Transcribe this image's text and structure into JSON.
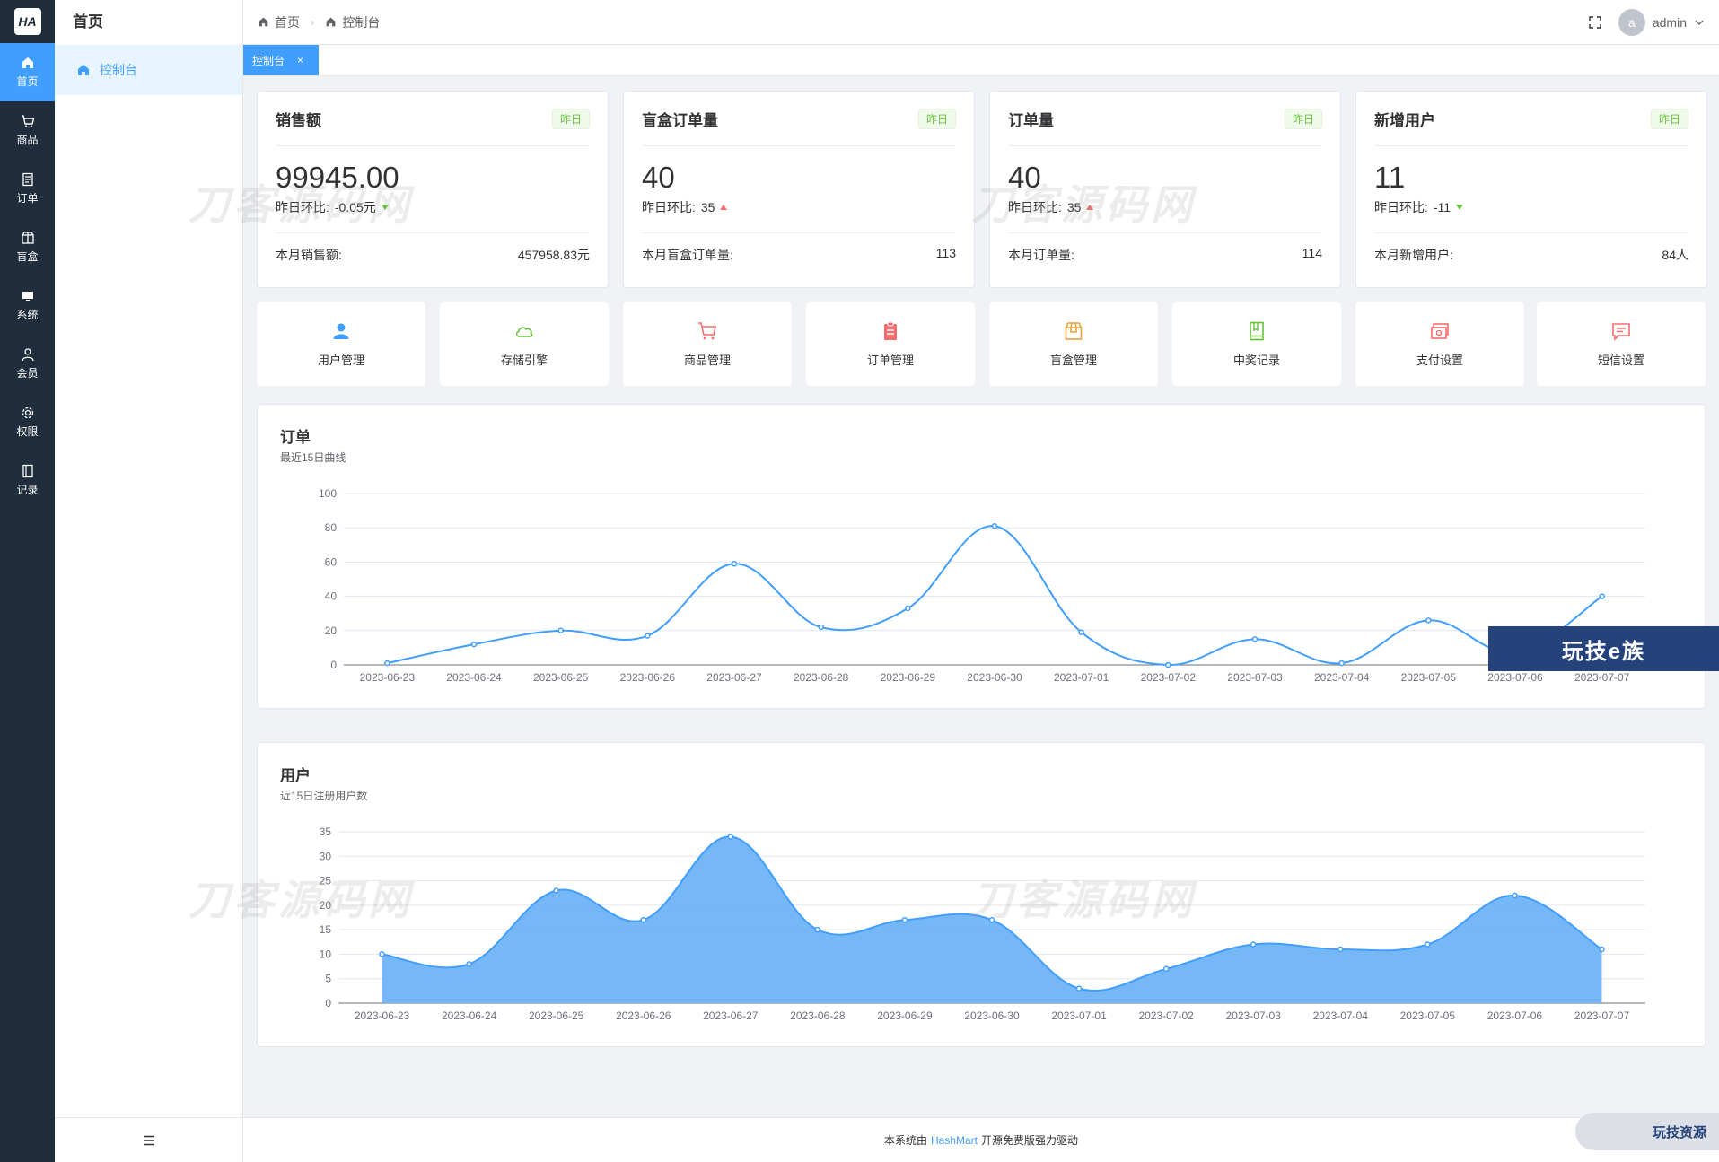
{
  "rail": {
    "logo": "HA",
    "items": [
      {
        "label": "首页",
        "icon": "home-icon"
      },
      {
        "label": "商品",
        "icon": "cart-icon"
      },
      {
        "label": "订单",
        "icon": "document-icon"
      },
      {
        "label": "盲盒",
        "icon": "box-icon"
      },
      {
        "label": "系统",
        "icon": "monitor-icon"
      },
      {
        "label": "会员",
        "icon": "user-icon"
      },
      {
        "label": "权限",
        "icon": "gear-icon"
      },
      {
        "label": "记录",
        "icon": "notebook-icon"
      }
    ]
  },
  "submenu": {
    "title": "首页",
    "item": "控制台"
  },
  "breadcrumb": {
    "home": "首页",
    "current": "控制台"
  },
  "user": {
    "avatar": "a",
    "name": "admin"
  },
  "tab": {
    "label": "控制台"
  },
  "stats": [
    {
      "name": "销售额",
      "badge": "昨日",
      "value": "99945.00",
      "compare_label": "昨日环比:",
      "compare_value": "-0.05元",
      "trend": "down",
      "month_label": "本月销售额:",
      "month_value": "457958.83元"
    },
    {
      "name": "盲盒订单量",
      "badge": "昨日",
      "value": "40",
      "compare_label": "昨日环比:",
      "compare_value": "35",
      "trend": "up",
      "month_label": "本月盲盒订单量:",
      "month_value": "113"
    },
    {
      "name": "订单量",
      "badge": "昨日",
      "value": "40",
      "compare_label": "昨日环比:",
      "compare_value": "35",
      "trend": "up",
      "month_label": "本月订单量:",
      "month_value": "114"
    },
    {
      "name": "新增用户",
      "badge": "昨日",
      "value": "11",
      "compare_label": "昨日环比:",
      "compare_value": "-11",
      "trend": "down",
      "month_label": "本月新增用户:",
      "month_value": "84人"
    }
  ],
  "quick_links": [
    {
      "label": "用户管理",
      "icon": "user-icon",
      "color": "#409eff"
    },
    {
      "label": "存储引擎",
      "icon": "cloud-icon",
      "color": "#67c23a"
    },
    {
      "label": "商品管理",
      "icon": "cart-icon",
      "color": "#f56c6c"
    },
    {
      "label": "订单管理",
      "icon": "clipboard-icon",
      "color": "#f56c6c"
    },
    {
      "label": "盲盒管理",
      "icon": "box-icon",
      "color": "#e6a23c"
    },
    {
      "label": "中奖记录",
      "icon": "book-icon",
      "color": "#67c23a"
    },
    {
      "label": "支付设置",
      "icon": "money-icon",
      "color": "#f56c6c"
    },
    {
      "label": "短信设置",
      "icon": "message-icon",
      "color": "#f56c6c"
    }
  ],
  "chart_data": [
    {
      "type": "line",
      "title": "订单",
      "subtitle": "最近15日曲线",
      "x": [
        "2023-06-23",
        "2023-06-24",
        "2023-06-25",
        "2023-06-26",
        "2023-06-27",
        "2023-06-28",
        "2023-06-29",
        "2023-06-30",
        "2023-07-01",
        "2023-07-02",
        "2023-07-03",
        "2023-07-04",
        "2023-07-05",
        "2023-07-06",
        "2023-07-07"
      ],
      "values": [
        1,
        12,
        20,
        17,
        59,
        22,
        33,
        81,
        19,
        0,
        15,
        1,
        26,
        7,
        40
      ],
      "ylim": [
        0,
        100
      ],
      "yticks": [
        0,
        20,
        40,
        60,
        80,
        100
      ],
      "color": "#409eff",
      "grid": true
    },
    {
      "type": "area",
      "title": "用户",
      "subtitle": "近15日注册用户数",
      "x": [
        "2023-06-23",
        "2023-06-24",
        "2023-06-25",
        "2023-06-26",
        "2023-06-27",
        "2023-06-28",
        "2023-06-29",
        "2023-06-30",
        "2023-07-01",
        "2023-07-02",
        "2023-07-03",
        "2023-07-04",
        "2023-07-05",
        "2023-07-06",
        "2023-07-07"
      ],
      "values": [
        10,
        8,
        23,
        17,
        34,
        15,
        17,
        17,
        3,
        7,
        12,
        11,
        12,
        22,
        11
      ],
      "ylim": [
        0,
        35
      ],
      "yticks": [
        0,
        5,
        10,
        15,
        20,
        25,
        30,
        35
      ],
      "color": "#409eff",
      "fill": "#6fb3f7",
      "grid": true
    }
  ],
  "watermarks": [
    "刀客源码网",
    "刀客源码网",
    "刀客源码网",
    "刀客源码网"
  ],
  "banner": "玩技e族",
  "footer": {
    "prefix": "本系统由",
    "brand": "HashMart",
    "suffix": "开源免费版强力驱动"
  },
  "corner_badge": "玩技资源"
}
